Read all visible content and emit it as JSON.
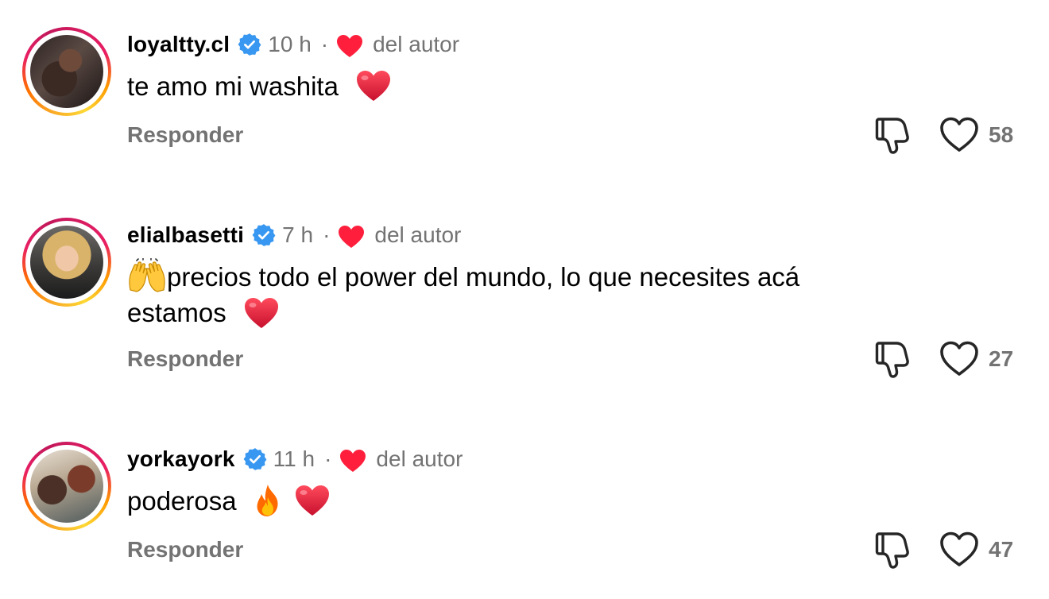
{
  "comments": [
    {
      "username": "loyaltty.cl",
      "time": "10 h",
      "separator": "·",
      "author_label": "del autor",
      "text": "te amo mi washita",
      "emojis": [
        "red-heart"
      ],
      "reply_label": "Responder",
      "likes": "58"
    },
    {
      "username": "elialbasetti",
      "time": "7 h",
      "separator": "·",
      "author_label": "del autor",
      "text_prefix_emoji": "raising-hands",
      "text_line1": "precios todo el power del mundo, lo que necesites acá",
      "text_line2": "estamos",
      "emojis": [
        "raising-hands",
        "red-heart"
      ],
      "reply_label": "Responder",
      "likes": "27"
    },
    {
      "username": "yorkayork",
      "time": "11 h",
      "separator": "·",
      "author_label": "del autor",
      "text": "poderosa",
      "emojis": [
        "fire",
        "red-heart"
      ],
      "reply_label": "Responder",
      "likes": "47"
    }
  ],
  "colors": {
    "verified_blue": "#3897f0",
    "author_heart_red": "#ff1f3d",
    "meta_gray": "#737373"
  },
  "icons": {
    "verified": "verified-badge-icon",
    "author_heart": "heart-filled-icon",
    "dislike": "thumbs-down-icon",
    "like": "heart-outline-icon"
  }
}
